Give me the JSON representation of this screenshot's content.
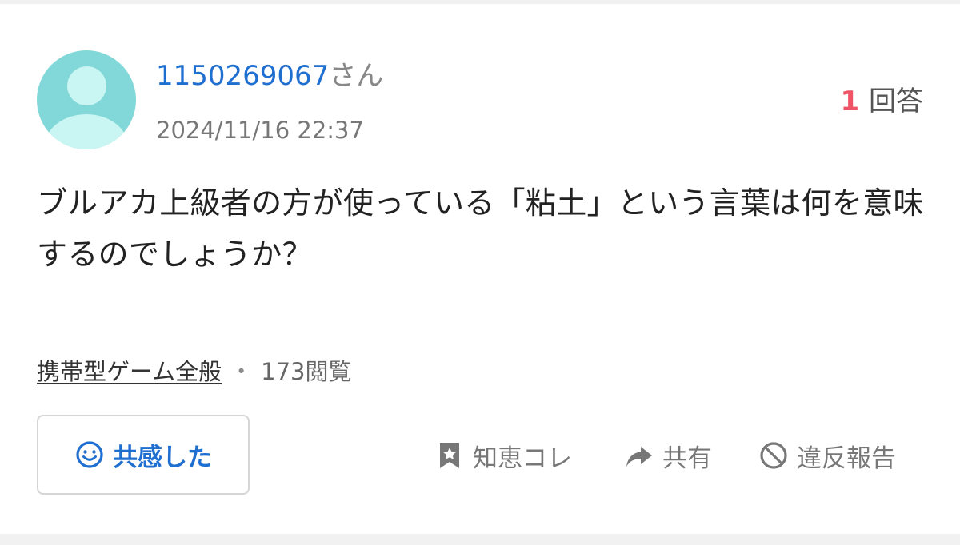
{
  "question": {
    "user": {
      "id": "1150269067",
      "suffix": "さん"
    },
    "timestamp": "2024/11/16 22:37",
    "answers": {
      "count": "1",
      "label": "回答"
    },
    "text": "ブルアカ上級者の方が使っている「粘土」という言葉は何を意味するのでしょうか？",
    "category": "携帯型ゲーム全般",
    "separator": "・",
    "views": "173閲覧"
  },
  "actions": {
    "empathy_label": "共感した",
    "chie_label": "知恵コレ",
    "share_label": "共有",
    "report_label": "違反報告"
  },
  "icons": {
    "avatar": "user-avatar-icon",
    "empathy": "smile-icon",
    "chie": "bookmark-star-icon",
    "share": "share-arrow-icon",
    "report": "prohibited-icon"
  },
  "colors": {
    "link_blue": "#1f6fd1",
    "answer_count_red": "#ef5366",
    "avatar_teal": "#82d8d8",
    "muted_gray": "#777777"
  }
}
